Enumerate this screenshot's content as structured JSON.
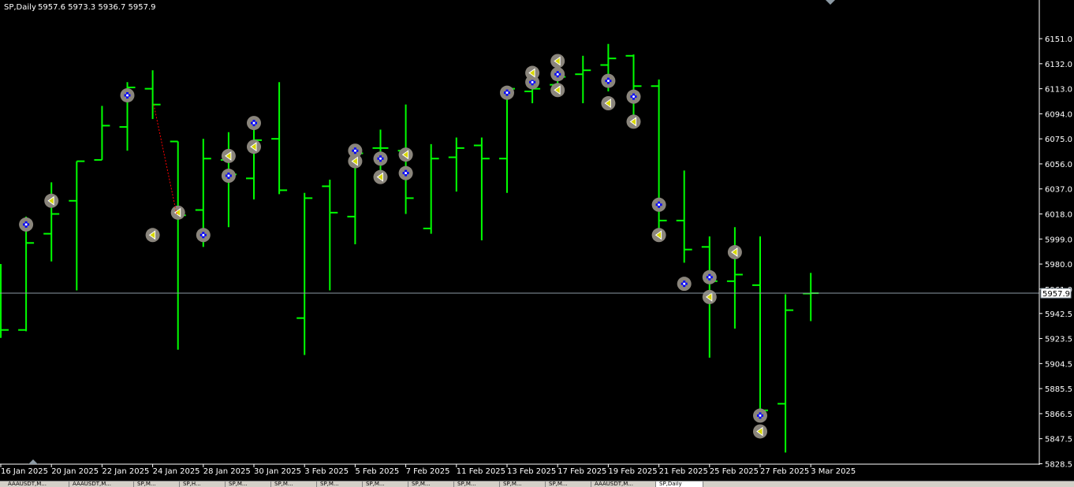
{
  "header": {
    "symbol": "SP,Daily",
    "ohlc": "5957.6 5973.3 5936.7 5957.9"
  },
  "price_label": "5957.9",
  "colors": {
    "background": "#000000",
    "bar": "#00ff00",
    "axis": "#ffffff",
    "price_line": "#8c9aa4",
    "arrow_line": "#ff0000",
    "marker_fill": "#8a857c",
    "buy_mark": "#0000ff",
    "sell_mark": "#d8d800"
  },
  "tabs": [
    {
      "label": "AAAUSDT,M..."
    },
    {
      "label": "AAAUSDT,M..."
    },
    {
      "label": "SP,M..."
    },
    {
      "label": "SP,H..."
    },
    {
      "label": "SP,M..."
    },
    {
      "label": "SP,M..."
    },
    {
      "label": "SP,M..."
    },
    {
      "label": "SP,M..."
    },
    {
      "label": "SP,M..."
    },
    {
      "label": "SP,M..."
    },
    {
      "label": "SP,M..."
    },
    {
      "label": "SP,M..."
    },
    {
      "label": "AAAUSDT,M..."
    },
    {
      "label": "SP,Daily",
      "active": true
    }
  ],
  "chart_data": {
    "type": "ohlc",
    "title": "SP,Daily",
    "ylim": [
      5824.0,
      6160.0
    ],
    "y_ticks": [
      "6151.0",
      "6132.0",
      "6113.0",
      "6094.0",
      "6075.0",
      "6056.0",
      "6037.0",
      "6018.0",
      "5999.0",
      "5980.0",
      "5961.0",
      "5942.5",
      "5923.5",
      "5904.5",
      "5885.5",
      "5866.5",
      "5847.5",
      "5828.5"
    ],
    "x_tick_labels": [
      {
        "label": "16 Jan 2025",
        "index": 0
      },
      {
        "label": "20 Jan 2025",
        "index": 2
      },
      {
        "label": "22 Jan 2025",
        "index": 4
      },
      {
        "label": "24 Jan 2025",
        "index": 6
      },
      {
        "label": "28 Jan 2025",
        "index": 8
      },
      {
        "label": "30 Jan 2025",
        "index": 10
      },
      {
        "label": "3 Feb 2025",
        "index": 12
      },
      {
        "label": "5 Feb 2025",
        "index": 14
      },
      {
        "label": "7 Feb 2025",
        "index": 16
      },
      {
        "label": "11 Feb 2025",
        "index": 18
      },
      {
        "label": "13 Feb 2025",
        "index": 20
      },
      {
        "label": "17 Feb 2025",
        "index": 22
      },
      {
        "label": "19 Feb 2025",
        "index": 24
      },
      {
        "label": "21 Feb 2025",
        "index": 26
      },
      {
        "label": "25 Feb 2025",
        "index": 28
      },
      {
        "label": "27 Feb 2025",
        "index": 30
      },
      {
        "label": "3 Mar 2025",
        "index": 32
      }
    ],
    "bars": [
      {
        "o": 5929,
        "h": 5980,
        "l": 5924,
        "c": 5930
      },
      {
        "o": 5930,
        "h": 6016,
        "l": 5929,
        "c": 5996
      },
      {
        "o": 6003,
        "h": 6042,
        "l": 5982,
        "c": 6018
      },
      {
        "o": 6028,
        "h": 6058,
        "l": 5960,
        "c": 6058
      },
      {
        "o": 6059,
        "h": 6100,
        "l": 6059,
        "c": 6085
      },
      {
        "o": 6084,
        "h": 6118,
        "l": 6066,
        "c": 6114
      },
      {
        "o": 6113,
        "h": 6127,
        "l": 6090,
        "c": 6101
      },
      {
        "o": 6073,
        "h": 6073,
        "l": 5915,
        "c": 6017
      },
      {
        "o": 6021,
        "h": 6075,
        "l": 5993,
        "c": 6060
      },
      {
        "o": 6059,
        "h": 6080,
        "l": 6008,
        "c": 6048
      },
      {
        "o": 6045,
        "h": 6086,
        "l": 6029,
        "c": 6074
      },
      {
        "o": 6075,
        "h": 6118,
        "l": 6033,
        "c": 6036
      },
      {
        "o": 5939,
        "h": 6034,
        "l": 5911,
        "c": 6030
      },
      {
        "o": 6039,
        "h": 6044,
        "l": 5960,
        "c": 6019
      },
      {
        "o": 6016,
        "h": 6066,
        "l": 5995,
        "c": 6064
      },
      {
        "o": 6068,
        "h": 6082,
        "l": 6046,
        "c": 6068
      },
      {
        "o": 6066,
        "h": 6101,
        "l": 6018,
        "c": 6030
      },
      {
        "o": 6007,
        "h": 6071,
        "l": 6003,
        "c": 6060
      },
      {
        "o": 6061,
        "h": 6076,
        "l": 6035,
        "c": 6068
      },
      {
        "o": 6070,
        "h": 6076,
        "l": 5998,
        "c": 6060
      },
      {
        "o": 6060,
        "h": 6115,
        "l": 6034,
        "c": 6113
      },
      {
        "o": 6111,
        "h": 6124,
        "l": 6102,
        "c": 6113
      },
      {
        "o": 6116,
        "h": 6130,
        "l": 6112,
        "c": 6122
      },
      {
        "o": 6124,
        "h": 6138,
        "l": 6102,
        "c": 6127
      },
      {
        "o": 6131,
        "h": 6147,
        "l": 6111,
        "c": 6136
      },
      {
        "o": 6138,
        "h": 6139,
        "l": 6085,
        "c": 6115
      },
      {
        "o": 6115,
        "h": 6120,
        "l": 6007,
        "c": 6013
      },
      {
        "o": 6013,
        "h": 6051,
        "l": 5981,
        "c": 5991
      },
      {
        "o": 5993,
        "h": 6001,
        "l": 5909,
        "c": 5967
      },
      {
        "o": 5967,
        "h": 6008,
        "l": 5931,
        "c": 5972
      },
      {
        "o": 5964,
        "h": 6001,
        "l": 5860,
        "c": 5869
      },
      {
        "o": 5874,
        "h": 5957,
        "l": 5837,
        "c": 5945
      },
      {
        "o": 5957.6,
        "h": 5973.3,
        "l": 5936.7,
        "c": 5957.9
      }
    ],
    "current_price": 5957.9,
    "buy_markers": [
      {
        "index": 1,
        "price": 6010
      },
      {
        "index": 5,
        "price": 6108
      },
      {
        "index": 9,
        "price": 6047
      },
      {
        "index": 10,
        "price": 6087
      },
      {
        "index": 8,
        "price": 6002
      },
      {
        "index": 14,
        "price": 6066
      },
      {
        "index": 15,
        "price": 6060
      },
      {
        "index": 16,
        "price": 6049
      },
      {
        "index": 20,
        "price": 6110
      },
      {
        "index": 21,
        "price": 6118
      },
      {
        "index": 22,
        "price": 6124
      },
      {
        "index": 24,
        "price": 6119
      },
      {
        "index": 25,
        "price": 6107
      },
      {
        "index": 26,
        "price": 6025
      },
      {
        "index": 27,
        "price": 5965
      },
      {
        "index": 28,
        "price": 5970
      },
      {
        "index": 30,
        "price": 5865
      }
    ],
    "sell_markers": [
      {
        "index": 2,
        "price": 6028
      },
      {
        "index": 6,
        "price": 6002
      },
      {
        "index": 7,
        "price": 6019
      },
      {
        "index": 9,
        "price": 6062
      },
      {
        "index": 10,
        "price": 6069
      },
      {
        "index": 14,
        "price": 6058
      },
      {
        "index": 15,
        "price": 6046
      },
      {
        "index": 16,
        "price": 6063
      },
      {
        "index": 21,
        "price": 6125
      },
      {
        "index": 22,
        "price": 6112
      },
      {
        "index": 22,
        "price": 6134
      },
      {
        "index": 24,
        "price": 6102
      },
      {
        "index": 25,
        "price": 6088
      },
      {
        "index": 26,
        "price": 6002
      },
      {
        "index": 28,
        "price": 5955
      },
      {
        "index": 29,
        "price": 5989
      },
      {
        "index": 30,
        "price": 5853
      }
    ]
  }
}
